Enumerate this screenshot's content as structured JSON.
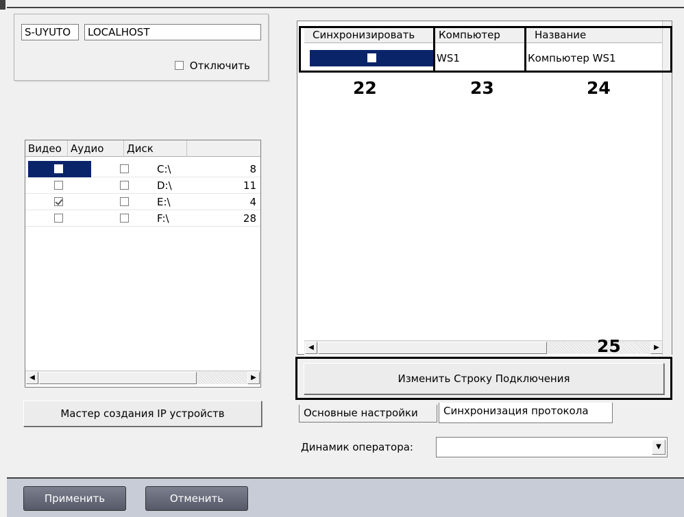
{
  "server": {
    "id_value": "S-UYUTO",
    "host_value": "LOCALHOST",
    "disable_label": "Отключить"
  },
  "disks": {
    "columns": [
      "Видео",
      "Аудио",
      "Диск"
    ],
    "rows": [
      {
        "video": false,
        "audio": false,
        "disk": "C:\\",
        "size": "8"
      },
      {
        "video": false,
        "audio": false,
        "disk": "D:\\",
        "size": "11"
      },
      {
        "video": true,
        "audio": false,
        "disk": "E:\\",
        "size": "4"
      },
      {
        "video": false,
        "audio": false,
        "disk": "F:\\",
        "size": "28"
      }
    ]
  },
  "ip_wizard_button": "Мастер создания IP устройств",
  "sync": {
    "columns": [
      "Синхронизировать",
      "Компьютер",
      "Название"
    ],
    "row": {
      "sync": false,
      "computer": "WS1",
      "name": "Компьютер WS1"
    },
    "callouts": [
      "22",
      "23",
      "24",
      "25"
    ],
    "change_button": "Изменить Строку Подключения"
  },
  "tabs": [
    "Основные настройки",
    "Синхронизация протокола"
  ],
  "operator_speaker": {
    "label": "Динамик оператора:",
    "value": ""
  },
  "footer": {
    "apply": "Применить",
    "cancel": "Отменить"
  },
  "colors": {
    "selection": "#0a246a",
    "footer_bg": "#c8ccd6"
  }
}
